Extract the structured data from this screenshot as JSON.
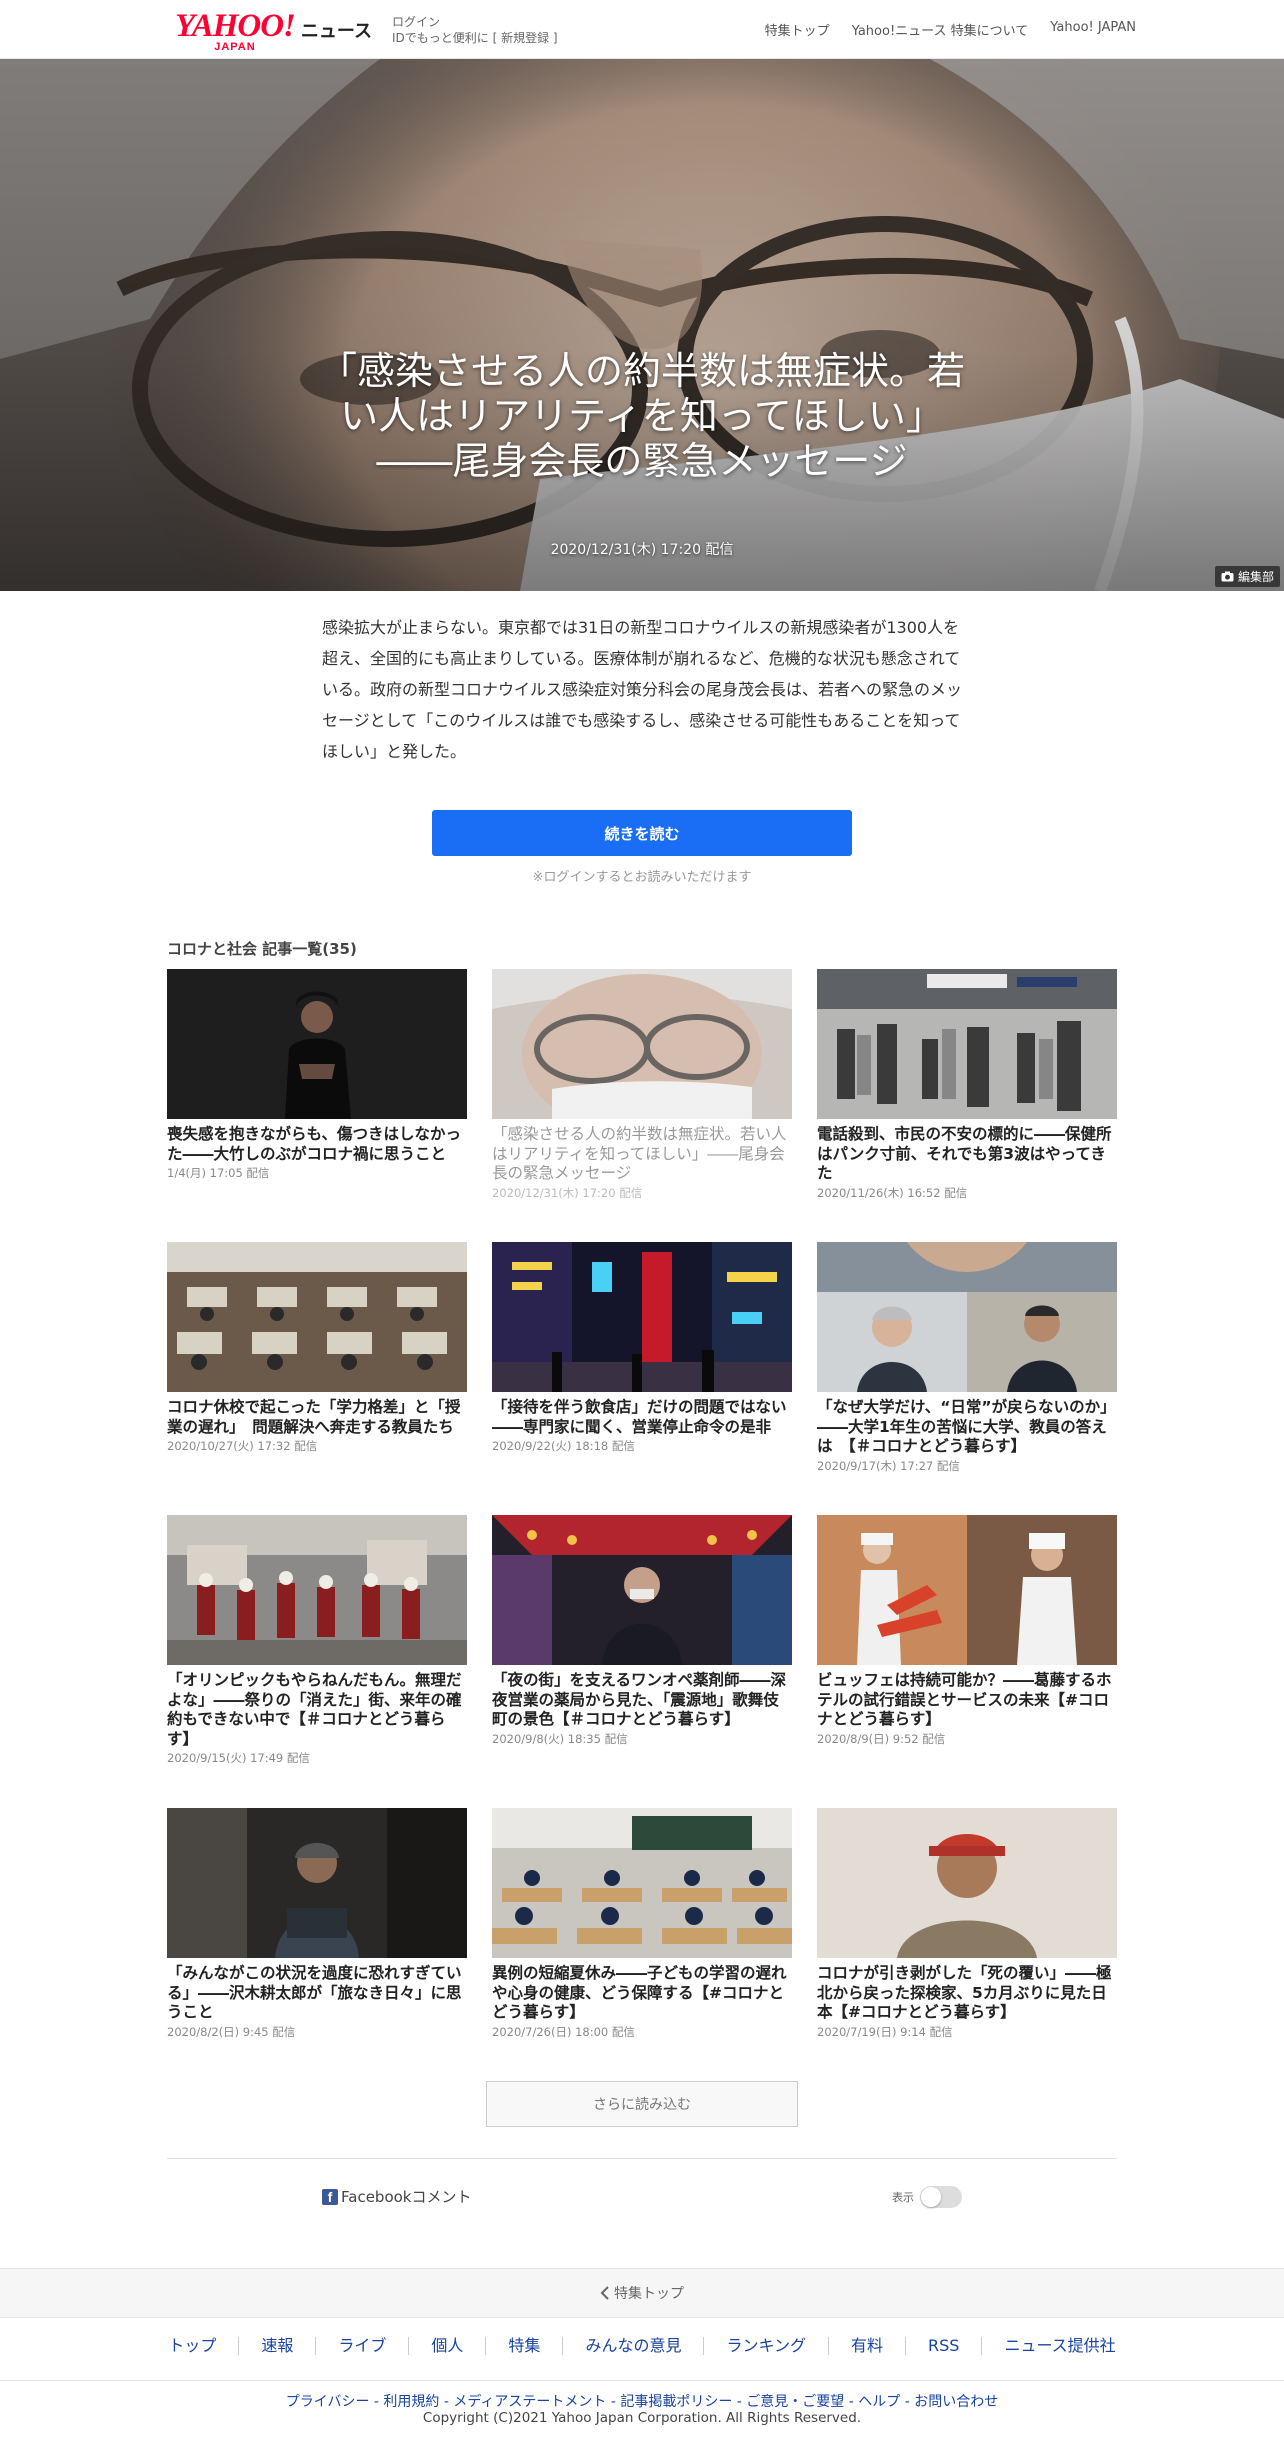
{
  "header": {
    "logo_main": "YAHOO!",
    "logo_sub": "JAPAN",
    "logo_service": "ニュース",
    "login": "ログイン",
    "login_sub": "IDでもっと便利に",
    "signup": "[ 新規登録 ]",
    "nav": [
      "特集トップ",
      "Yahoo!ニュース 特集について",
      "Yahoo! JAPAN"
    ]
  },
  "hero": {
    "title": "「感染させる人の約半数は無症状。若い人はリアリティを知ってほしい」――尾身会長の緊急メッセージ",
    "date": "2020/12/31(木) 17:20 配信",
    "credit": "編集部"
  },
  "lead": {
    "text": "感染拡大が止まらない。東京都では31日の新型コロナウイルスの新規感染者が1300人を超え、全国的にも高止まりしている。医療体制が崩れるなど、危機的な状況も懸念されている。政府の新型コロナウイルス感染症対策分科会の尾身茂会長は、若者への緊急のメッセージとして「このウイルスは誰でも感染するし、感染させる可能性もあることを知ってほしい」と発した。",
    "button": "続きを読む",
    "note": "※ログインするとお読みいただけます"
  },
  "list": {
    "title": "コロナと社会 記事一覧(35)",
    "articles": [
      {
        "title": "喪失感を抱きながらも、傷つきはしなかった――大竹しのぶがコロナ禍に思うこと",
        "date": "1/4(月) 17:05 配信"
      },
      {
        "title": "「感染させる人の約半数は無症状。若い人はリアリティを知ってほしい」――尾身会長の緊急メッセージ",
        "date": "2020/12/31(木) 17:20 配信"
      },
      {
        "title": "電話殺到、市民の不安の標的に――保健所はパンク寸前、それでも第3波はやってきた",
        "date": "2020/11/26(木) 16:52 配信"
      },
      {
        "title": "コロナ休校で起こった「学力格差」と「授業の遅れ」　問題解決へ奔走する教員たち",
        "date": "2020/10/27(火) 17:32 配信"
      },
      {
        "title": "「接待を伴う飲食店」だけの問題ではない――専門家に聞く、営業停止命令の是非",
        "date": "2020/9/22(火) 18:18 配信"
      },
      {
        "title": "「なぜ大学だけ、“日常”が戻らないのか」――大学1年生の苦悩に大学、教員の答えは　【＃コロナとどう暮らす】",
        "date": "2020/9/17(木) 17:27 配信"
      },
      {
        "title": "「オリンピックもやらねんだもん。無理だよな」――祭りの「消えた」街、来年の確約もできない中で【＃コロナとどう暮らす】",
        "date": "2020/9/15(火) 17:49 配信"
      },
      {
        "title": "「夜の街」を支えるワンオペ薬剤師――深夜営業の薬局から見た、「震源地」歌舞伎町の景色【＃コロナとどう暮らす】",
        "date": "2020/9/8(火) 18:35 配信"
      },
      {
        "title": "ビュッフェは持続可能か？――葛藤するホテルの試行錯誤とサービスの未来【#コロナとどう暮らす】",
        "date": "2020/8/9(日) 9:52 配信"
      },
      {
        "title": "「みんながこの状況を過度に恐れすぎている」――沢木耕太郎が「旅なき日々」に思うこと",
        "date": "2020/8/2(日) 9:45 配信"
      },
      {
        "title": "異例の短縮夏休み――子どもの学習の遅れや心身の健康、どう保障する【#コロナとどう暮らす】",
        "date": "2020/7/26(日) 18:00 配信"
      },
      {
        "title": "コロナが引き剥がした「死の覆い」――極北から戻った探検家、5カ月ぶりに見た日本【#コロナとどう暮らす】",
        "date": "2020/7/19(日) 9:14 配信"
      }
    ],
    "more": "さらに読み込む"
  },
  "facebook": {
    "label": "Facebookコメント",
    "icon_letter": "f",
    "toggle_label": "表示"
  },
  "footer": {
    "back": "特集トップ",
    "nav": [
      "トップ",
      "速報",
      "ライブ",
      "個人",
      "特集",
      "みんなの意見",
      "ランキング",
      "有料",
      "RSS",
      "ニュース提供社"
    ],
    "links": "プライバシー - 利用規約 - メディアステートメント - 記事掲載ポリシー - ご意見・ご要望 - ヘルプ - お問い合わせ",
    "copyright": "Copyright (C)2021 Yahoo Japan Corporation. All Rights Reserved."
  },
  "colors": {
    "brand": "#ff0033",
    "button": "#1a6ef5",
    "link": "#1a44a0",
    "facebook": "#3b5998"
  }
}
